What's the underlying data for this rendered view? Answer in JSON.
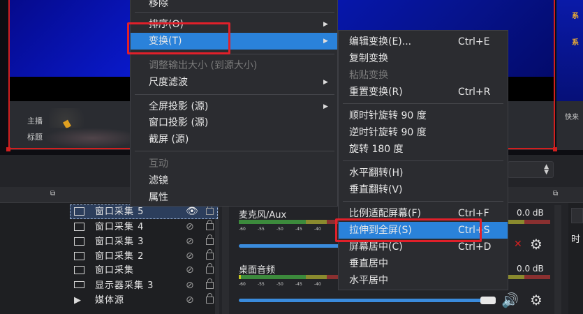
{
  "preview": {
    "right_label_1": "系",
    "right_label_2": "系",
    "right_label_3": "快来",
    "lower_label_1": "主播",
    "lower_label_2": "标题"
  },
  "context_menu": {
    "items": [
      {
        "label": "移除",
        "disabled": false
      },
      {
        "label": "排序(O)",
        "disabled": false,
        "submenu": true
      },
      {
        "label": "变换(T)",
        "disabled": false,
        "submenu": true,
        "highlighted": true
      },
      {
        "label": "调整输出大小 (到源大小)",
        "disabled": true
      },
      {
        "label": "尺度滤波",
        "disabled": false,
        "submenu": true
      },
      {
        "label": "全屏投影 (源)",
        "disabled": false,
        "submenu": true
      },
      {
        "label": "窗口投影 (源)",
        "disabled": false
      },
      {
        "label": "截屏 (源)",
        "disabled": false
      },
      {
        "label": "互动",
        "disabled": true
      },
      {
        "label": "滤镜",
        "disabled": false
      },
      {
        "label": "属性",
        "disabled": false
      }
    ]
  },
  "transform_menu": {
    "items": [
      {
        "label": "编辑变换(E)...",
        "shortcut": "Ctrl+E",
        "disabled": false
      },
      {
        "label": "复制变换",
        "shortcut": "",
        "disabled": false
      },
      {
        "label": "粘贴变换",
        "shortcut": "",
        "disabled": true
      },
      {
        "label": "重置变换(R)",
        "shortcut": "Ctrl+R",
        "disabled": false
      },
      {
        "label": "顺时针旋转 90 度",
        "shortcut": "",
        "disabled": false
      },
      {
        "label": "逆时针旋转 90 度",
        "shortcut": "",
        "disabled": false
      },
      {
        "label": "旋转 180 度",
        "shortcut": "",
        "disabled": false
      },
      {
        "label": "水平翻转(H)",
        "shortcut": "",
        "disabled": false
      },
      {
        "label": "垂直翻转(V)",
        "shortcut": "",
        "disabled": false
      },
      {
        "label": "比例适配屏幕(F)",
        "shortcut": "Ctrl+F",
        "disabled": false
      },
      {
        "label": "拉伸到全屏(S)",
        "shortcut": "Ctrl+S",
        "disabled": false,
        "highlighted": true
      },
      {
        "label": "屏幕居中(C)",
        "shortcut": "Ctrl+D",
        "disabled": false
      },
      {
        "label": "垂直居中",
        "shortcut": "",
        "disabled": false
      },
      {
        "label": "水平居中",
        "shortcut": "",
        "disabled": false
      }
    ]
  },
  "sources": {
    "items": [
      {
        "label": "窗口采集 5",
        "icon": "window-icon",
        "visible": true
      },
      {
        "label": "窗口采集 4",
        "icon": "window-icon",
        "visible": false
      },
      {
        "label": "窗口采集 3",
        "icon": "window-icon",
        "visible": false
      },
      {
        "label": "窗口采集 2",
        "icon": "window-icon",
        "visible": false
      },
      {
        "label": "窗口采集",
        "icon": "window-icon",
        "visible": false
      },
      {
        "label": "显示器采集 3",
        "icon": "monitor-icon",
        "visible": false
      },
      {
        "label": "媒体源",
        "icon": "play-icon",
        "visible": false
      }
    ]
  },
  "mixer": {
    "channels": [
      {
        "name": "麦克风/Aux",
        "db": "0.0 dB",
        "muted": true
      },
      {
        "name": "桌面音频",
        "db": "0.0 dB",
        "muted": false
      }
    ],
    "scale_ticks": [
      "-60",
      "-55",
      "-50",
      "-45",
      "-40",
      "-35",
      "-30",
      "-25",
      "-20",
      "-15",
      "-10",
      "-5",
      "0"
    ]
  },
  "right_dock": {
    "label": "时"
  },
  "colors": {
    "highlight": "#2a82da",
    "annotation_red": "#e0202a",
    "selection_red": "#d21f1f"
  }
}
